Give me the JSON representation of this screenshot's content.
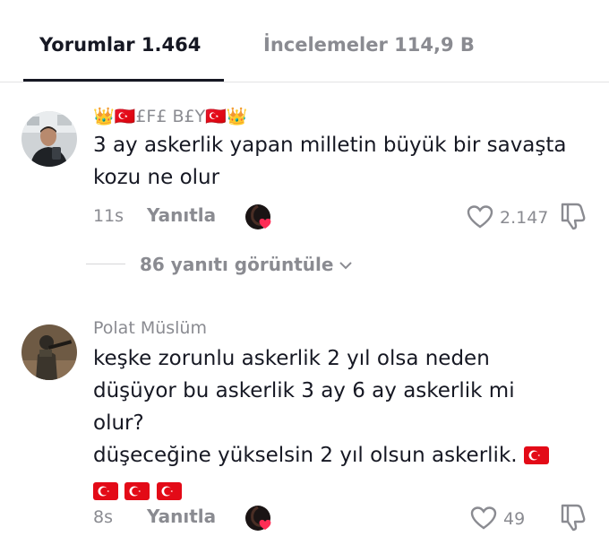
{
  "tabs": {
    "comments_label": "Yorumlar 1.464",
    "reviews_label": "İncelemeler 114,9 B"
  },
  "comments": [
    {
      "username": "👑🇹🇷£F£ B£Y🇹🇷👑",
      "text": "3 ay askerlik yapan milletin büyük bir savaşta kozu ne olur",
      "time": "11s",
      "reply_label": "Yanıtla",
      "likes": "2.147"
    },
    {
      "username": "Polat Müslüm",
      "text_lines": [
        "keşke zorunlu askerlik 2 yıl olsa neden",
        "düşüyor bu askerlik 3 ay 6 ay askerlik mi",
        "olur?",
        "düşeceğine yükselsin 2 yıl olsun askerlik."
      ],
      "time": "8s",
      "reply_label": "Yanıtla",
      "likes": "49"
    }
  ],
  "view_replies": "86 yanıtı görüntüle",
  "colors": {
    "text": "#161823",
    "muted": "#8a8b91",
    "like_red": "#fe2c55",
    "flag_red": "#e30a17"
  },
  "icons": [
    "heart-icon",
    "dislike-icon",
    "chevron-down-icon",
    "creator-liked-icon",
    "turkey-flag-icon"
  ]
}
